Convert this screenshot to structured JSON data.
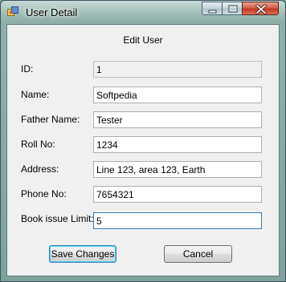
{
  "window": {
    "title": "User Detail",
    "icon": "form-window-icon",
    "controls": [
      "minimize-icon",
      "maximize-icon",
      "close-icon"
    ]
  },
  "form": {
    "heading": "Edit User",
    "fields": [
      {
        "label": "ID:",
        "value": "1",
        "readonly": true
      },
      {
        "label": "Name:",
        "value": "Softpedia"
      },
      {
        "label": "Father Name:",
        "value": "Tester"
      },
      {
        "label": "Roll No:",
        "value": "1234"
      },
      {
        "label": "Address:",
        "value": "Line 123, area 123, Earth"
      },
      {
        "label": "Phone No:",
        "value": "7654321"
      },
      {
        "label": "Book issue Limit:",
        "value": "5",
        "focused": true
      }
    ]
  },
  "buttons": {
    "save": "Save Changes",
    "cancel": "Cancel"
  },
  "colors": {
    "client_bg": "#f0f0f0",
    "focus_border": "#3d7bad",
    "default_button_border": "#3c7fb1"
  }
}
